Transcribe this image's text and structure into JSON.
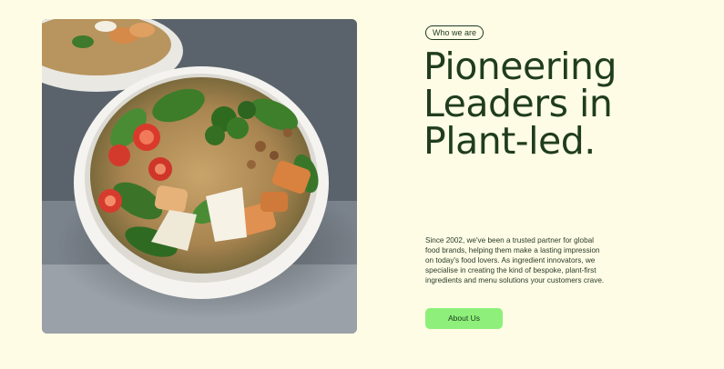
{
  "hero": {
    "image_alt": "Salad bowl with chicken, quinoa, spinach, broccoli and tomatoes",
    "tag": "Who we are",
    "headline_lines": [
      "Pioneering",
      "Leaders in",
      "Plant-led."
    ],
    "intro_lines": [
      "Since 2002, we've been a trusted partner for global",
      "food brands, helping them make a lasting impression",
      "on today's food lovers. As ingredient innovators, we",
      "specialise in creating the kind of bespoke, plant-first",
      "ingredients and menu solutions your customers crave."
    ],
    "cta_label": "About Us"
  },
  "colors": {
    "background": "#fffce6",
    "text": "#1d3b1e",
    "accent": "#8ef07a"
  }
}
